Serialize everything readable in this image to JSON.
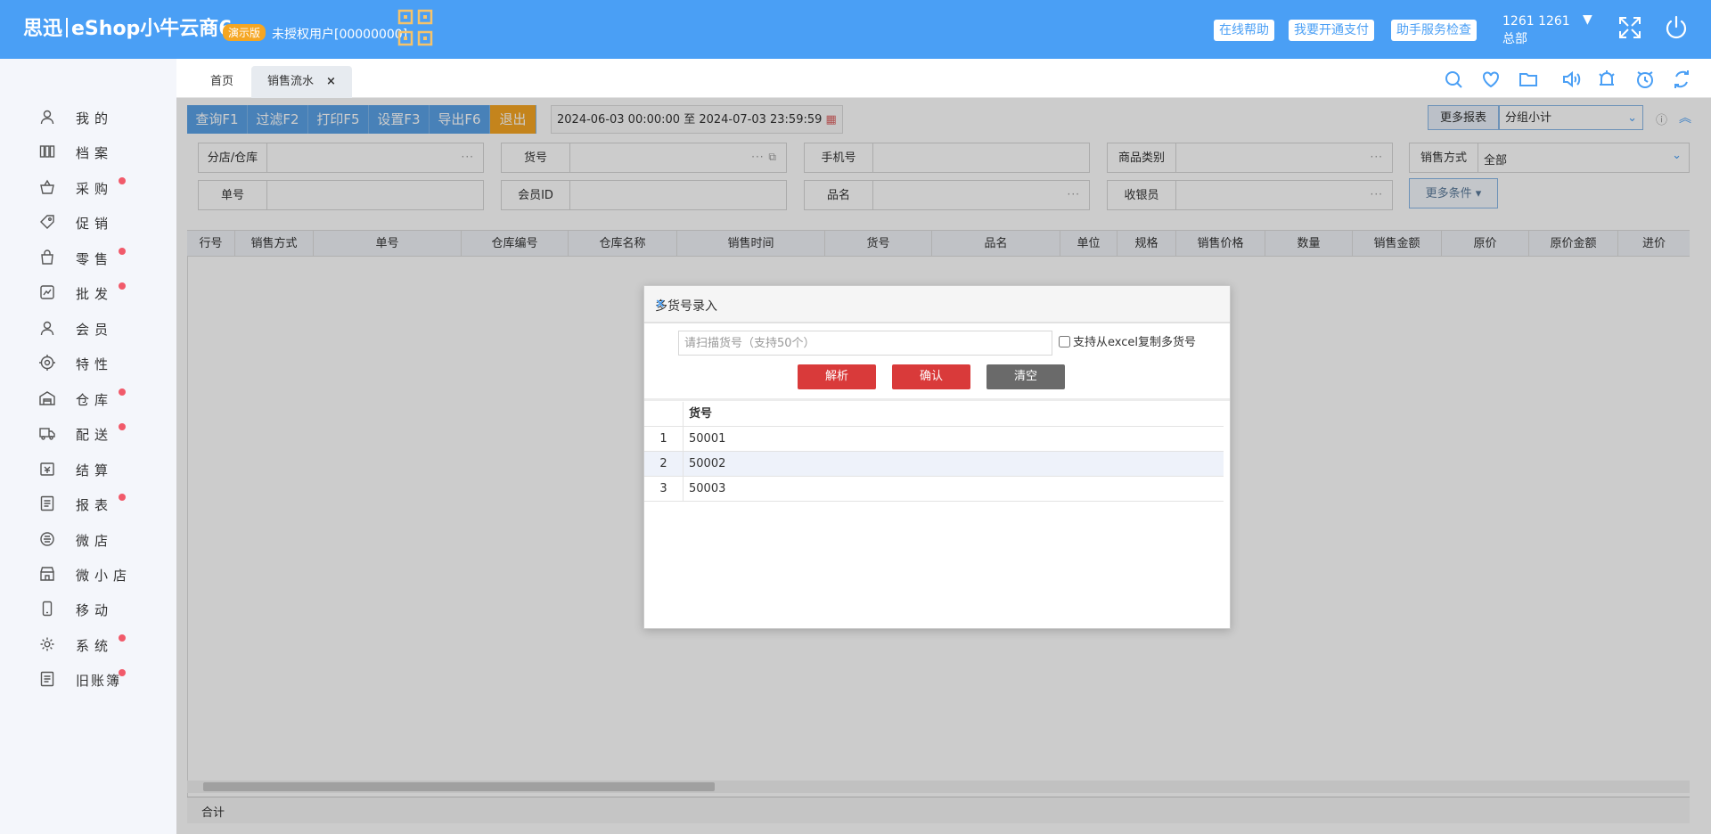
{
  "header": {
    "brand_cn": "思迅",
    "brand_product": "eShop小牛云商6",
    "demo_badge": "演示版",
    "license_text": "未授权用户[00000000]",
    "buttons": [
      "在线帮助",
      "我要开通支付",
      "助手服务检查"
    ],
    "user_id": "1261 1261",
    "user_branch": "总部"
  },
  "sidebar": {
    "items": [
      {
        "label": "我的",
        "icon": "user-icon",
        "dot": false
      },
      {
        "label": "档案",
        "icon": "archive-icon",
        "dot": false
      },
      {
        "label": "采购",
        "icon": "basket-icon",
        "dot": true
      },
      {
        "label": "促销",
        "icon": "tag-icon",
        "dot": false
      },
      {
        "label": "零售",
        "icon": "bag-icon",
        "dot": true
      },
      {
        "label": "批发",
        "icon": "wholesale-icon",
        "dot": true
      },
      {
        "label": "会员",
        "icon": "member-icon",
        "dot": false
      },
      {
        "label": "特性",
        "icon": "target-icon",
        "dot": false
      },
      {
        "label": "仓库",
        "icon": "warehouse-icon",
        "dot": true
      },
      {
        "label": "配送",
        "icon": "truck-icon",
        "dot": true
      },
      {
        "label": "结算",
        "icon": "settle-icon",
        "dot": false
      },
      {
        "label": "报表",
        "icon": "report-icon",
        "dot": true
      },
      {
        "label": "微店",
        "icon": "wechat-shop-icon",
        "dot": false
      },
      {
        "label": "微小店",
        "icon": "mini-shop-icon",
        "dot": false
      },
      {
        "label": "移动",
        "icon": "mobile-icon",
        "dot": false
      },
      {
        "label": "系统",
        "icon": "gear-icon",
        "dot": true
      },
      {
        "label": "旧账簿",
        "icon": "ledger-icon",
        "dot": true
      }
    ]
  },
  "tabs": {
    "home": "首页",
    "active": "销售流水",
    "close": "×"
  },
  "toolbar": {
    "buttons": [
      "查询F1",
      "过滤F2",
      "打印F5",
      "设置F3",
      "导出F6"
    ],
    "exit": "退出",
    "date_range": "2024-06-03 00:00:00  至  2024-07-03 23:59:59",
    "more_reports": "更多报表",
    "group_select": "分组小计",
    "more_conditions": "更多条件 ▾"
  },
  "filters": {
    "row1": [
      "分店/仓库",
      "货号",
      "手机号",
      "商品类别",
      "销售方式"
    ],
    "row2": [
      "单号",
      "会员ID",
      "品名",
      "收银员"
    ],
    "sale_mode_value": "全部"
  },
  "grid": {
    "columns": [
      "行号",
      "销售方式",
      "单号",
      "仓库编号",
      "仓库名称",
      "销售时间",
      "货号",
      "品名",
      "单位",
      "规格",
      "销售价格",
      "数量",
      "销售金额",
      "原价",
      "原价金额",
      "进价"
    ],
    "total_label": "合计"
  },
  "modal": {
    "title": "多货号录入",
    "close": "×",
    "input_placeholder": "请扫描货号（支持50个）",
    "excel_checkbox": "支持从excel复制多货号",
    "buttons": {
      "parse": "解析",
      "confirm": "确认",
      "clear": "清空"
    },
    "table_header": "货号",
    "rows": [
      {
        "index": "1",
        "code": "50001"
      },
      {
        "index": "2",
        "code": "50002"
      },
      {
        "index": "3",
        "code": "50003"
      }
    ]
  },
  "colors": {
    "header_blue": "#4a9ff5",
    "exit_orange": "#f5a623",
    "parse_red": "#d93a3a",
    "clear_gray": "#6a6a6a",
    "notify_dot": "#f15a6a"
  }
}
